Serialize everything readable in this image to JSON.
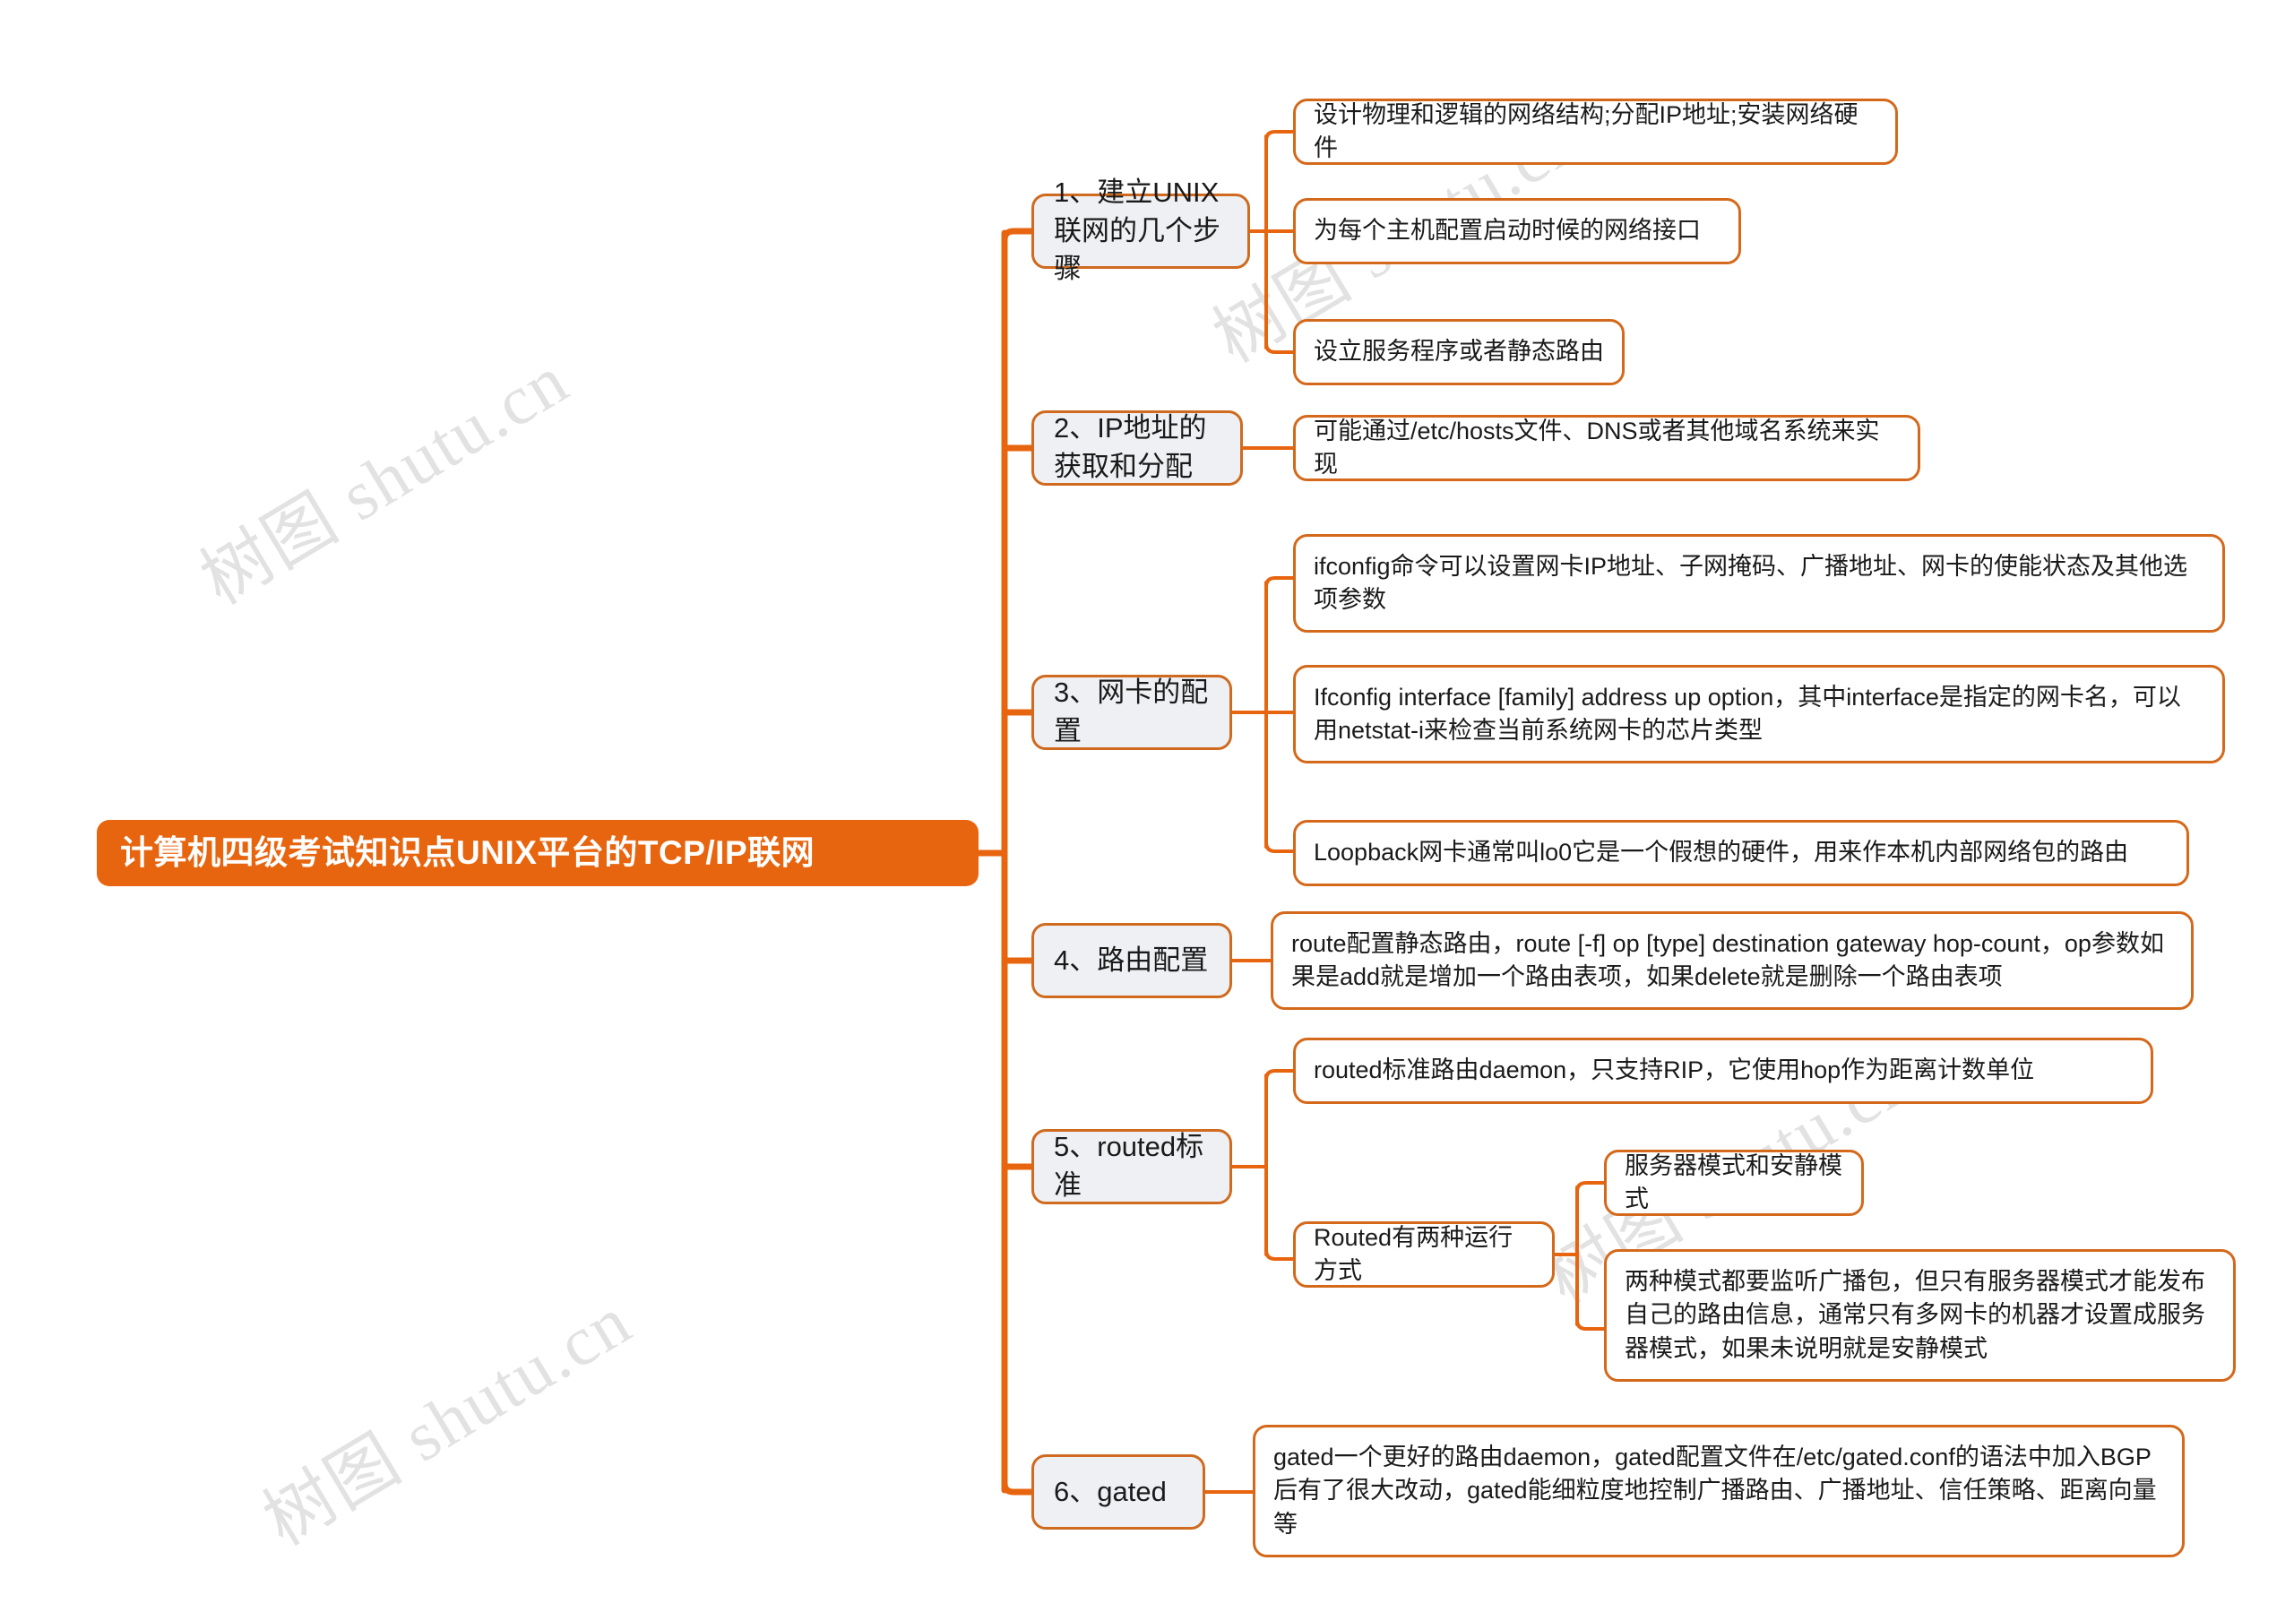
{
  "title": "计算机四级考试知识点UNIX平台的TCP/IP联网",
  "watermark": "树图 shutu.cn",
  "colors": {
    "root_fill": "#e8650f",
    "branch_fill": "#eef0f3",
    "border": "#d4691b",
    "connector": "#e8650f",
    "text": "#1a1a1a",
    "watermark": "#e2e2e2"
  },
  "branches": [
    {
      "label": "1、建立UNIX联网的几个步骤",
      "children": [
        {
          "label": "设计物理和逻辑的网络结构;分配IP地址;安装网络硬件"
        },
        {
          "label": "为每个主机配置启动时候的网络接口"
        },
        {
          "label": "设立服务程序或者静态路由"
        }
      ]
    },
    {
      "label": "2、IP地址的获取和分配",
      "children": [
        {
          "label": "可能通过/etc/hosts文件、DNS或者其他域名系统来实现"
        }
      ]
    },
    {
      "label": "3、网卡的配置",
      "children": [
        {
          "label": "ifconfig命令可以设置网卡IP地址、子网掩码、广播地址、网卡的使能状态及其他选项参数"
        },
        {
          "label": "Ifconfig interface [family] address up option，其中interface是指定的网卡名，可以用netstat-i来检查当前系统网卡的芯片类型"
        },
        {
          "label": "Loopback网卡通常叫lo0它是一个假想的硬件，用来作本机内部网络包的路由"
        }
      ]
    },
    {
      "label": "4、路由配置",
      "children": [
        {
          "label": "route配置静态路由，route [-f] op [type] destination gateway hop-count，op参数如果是add就是增加一个路由表项，如果delete就是删除一个路由表项"
        }
      ]
    },
    {
      "label": "5、routed标准",
      "children": [
        {
          "label": "routed标准路由daemon，只支持RIP，它使用hop作为距离计数单位"
        },
        {
          "label": "Routed有两种运行方式",
          "children": [
            {
              "label": "服务器模式和安静模式"
            },
            {
              "label": "两种模式都要监听广播包，但只有服务器模式才能发布自己的路由信息，通常只有多网卡的机器才设置成服务器模式，如果未说明就是安静模式"
            }
          ]
        }
      ]
    },
    {
      "label": "6、gated",
      "children": [
        {
          "label": "gated一个更好的路由daemon，gated配置文件在/etc/gated.conf的语法中加入BGP后有了很大改动，gated能细粒度地控制广播路由、广播地址、信任策略、距离向量等"
        }
      ]
    }
  ]
}
